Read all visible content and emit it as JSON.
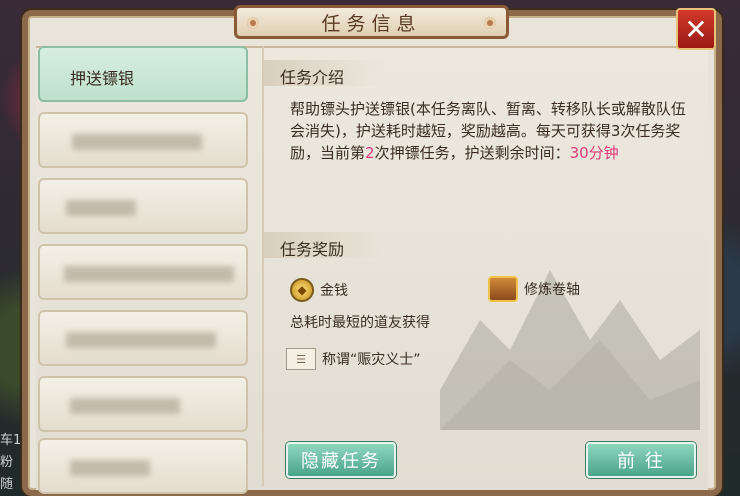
{
  "window": {
    "title": "任务信息"
  },
  "close_label": "✕",
  "task_list": [
    {
      "label": "押送镖银",
      "active": true
    },
    {
      "label": "",
      "active": false
    },
    {
      "label": "",
      "active": false
    },
    {
      "label": "",
      "active": false
    },
    {
      "label": "",
      "active": false
    },
    {
      "label": "",
      "active": false
    },
    {
      "label": "",
      "active": false
    }
  ],
  "intro": {
    "heading": "任务介绍",
    "text_part1": "帮助镖头护送镖银(本任务离队、暂离、转移队长或解散队伍会消失)，护送耗时越短，奖励越高。每天可获得3次任务奖励，当前第",
    "current_count": "2",
    "text_part2": "次押镖任务，护送剩余时间：",
    "remaining_time": "30分钟"
  },
  "rewards": {
    "heading": "任务奖励",
    "gold_label": "金钱",
    "scroll_label": "修炼卷轴",
    "note": "总耗时最短的道友获得",
    "title_label": "称谓“赈灾义士”"
  },
  "buttons": {
    "hide": "隐藏任务",
    "go": "前 往"
  },
  "side_chat": [
    "车1",
    "粉",
    "随"
  ],
  "colors": {
    "highlight": "#e03a7a",
    "button_green": "#4aa58a",
    "close_red": "#c0281c"
  },
  "icons": {
    "gold": "gold-coin-icon",
    "scroll": "treasure-chest-icon",
    "title": "title-card-icon",
    "close": "close-icon"
  }
}
